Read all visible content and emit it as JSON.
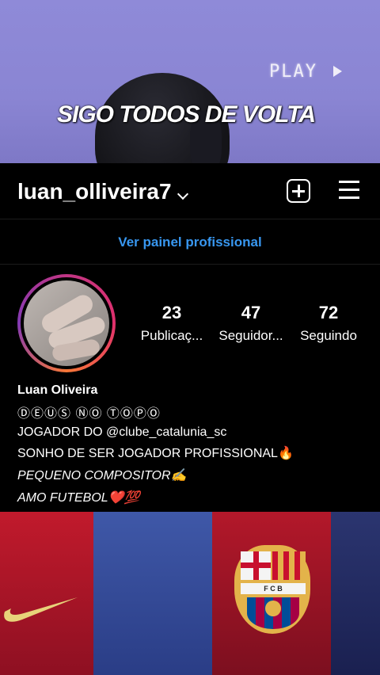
{
  "overlay": {
    "play_text": "PLAY",
    "caption": "SIGO TODOS DE VOLTA"
  },
  "header": {
    "username": "luan_olliveira7"
  },
  "professional": {
    "link_text": "Ver painel profissional"
  },
  "stats": [
    {
      "value": "23",
      "label": "Publicaç..."
    },
    {
      "value": "47",
      "label": "Seguidor..."
    },
    {
      "value": "72",
      "label": "Seguindo"
    }
  ],
  "bio": {
    "name": "Luan Oliveira",
    "tagline": "ⒹⒺⓊⓈ ⓃⓄ ⓉⓄⓅⓄ",
    "line1": "JOGADOR DO @clube_catalunia_sc",
    "line2": "SONHO DE SER JOGADOR PROFISSIONAL🔥",
    "line3": "PEQUENO COMPOSITOR✍️",
    "line4": "AMO FUTEBOL❤️💯"
  },
  "crest": {
    "band_text": "F C B"
  },
  "colors": {
    "link_blue": "#3897f0",
    "background": "#000000",
    "overlay_purple": "#8a85d3"
  }
}
